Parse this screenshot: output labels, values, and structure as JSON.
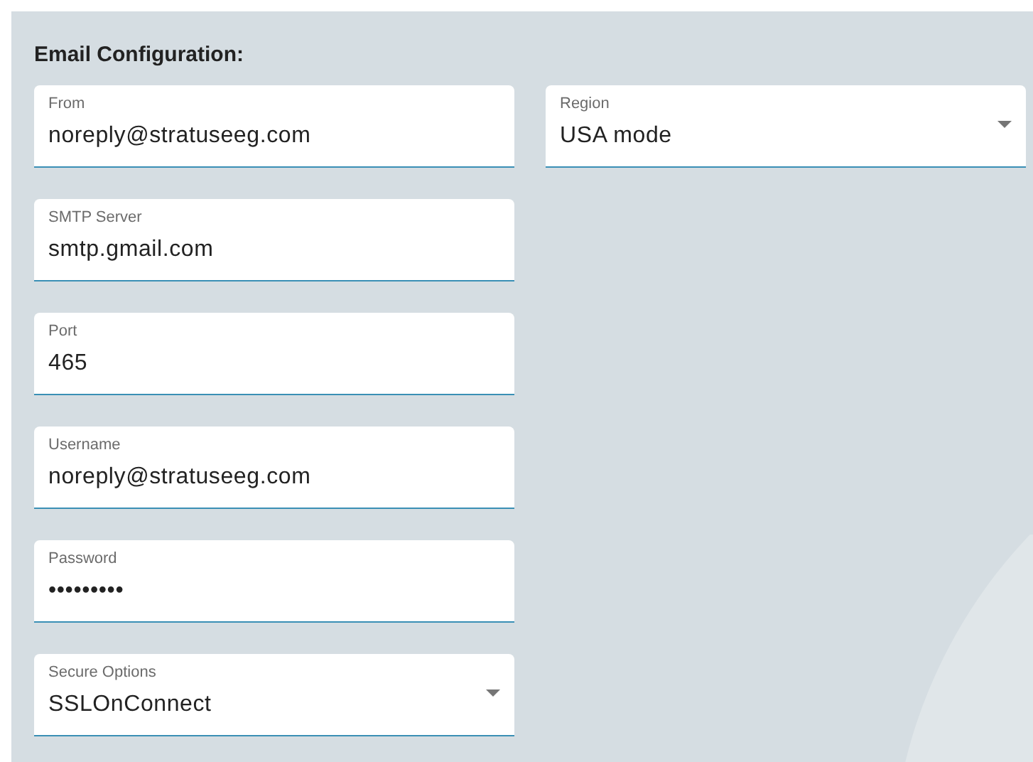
{
  "title": "Email Configuration:",
  "left_fields": [
    {
      "kind": "text",
      "label": "From",
      "value": "noreply@stratuseeg.com"
    },
    {
      "kind": "text",
      "label": "SMTP Server",
      "value": "smtp.gmail.com"
    },
    {
      "kind": "text",
      "label": "Port",
      "value": "465"
    },
    {
      "kind": "text",
      "label": "Username",
      "value": "noreply@stratuseeg.com"
    },
    {
      "kind": "password",
      "label": "Password",
      "value": "•••••••••"
    },
    {
      "kind": "select",
      "label": "Secure Options",
      "value": "SSLOnConnect"
    }
  ],
  "right_fields": [
    {
      "kind": "select",
      "label": "Region",
      "value": "USA mode"
    }
  ]
}
